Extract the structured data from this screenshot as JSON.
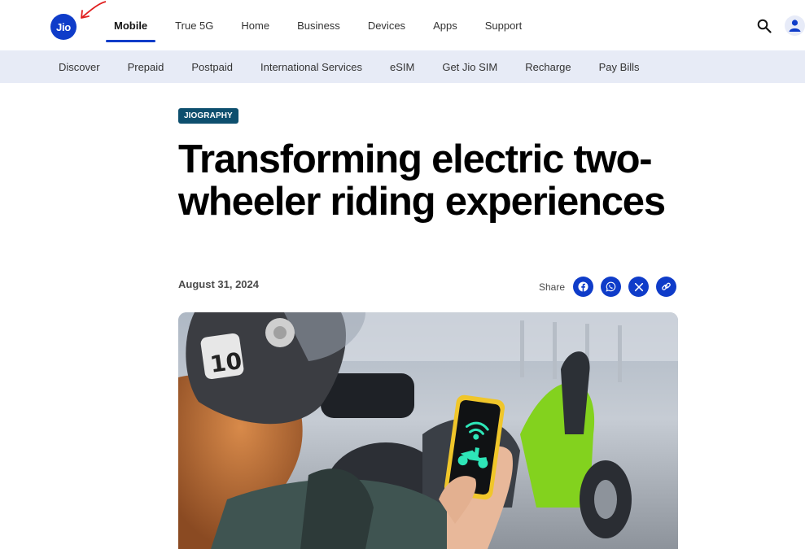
{
  "header": {
    "logo_text": "Jio",
    "nav": [
      {
        "label": "Mobile",
        "active": true
      },
      {
        "label": "True 5G"
      },
      {
        "label": "Home"
      },
      {
        "label": "Business"
      },
      {
        "label": "Devices"
      },
      {
        "label": "Apps"
      },
      {
        "label": "Support"
      }
    ]
  },
  "subnav": [
    "Discover",
    "Prepaid",
    "Postpaid",
    "International Services",
    "eSIM",
    "Get Jio SIM",
    "Recharge",
    "Pay Bills"
  ],
  "article": {
    "category": "JIOGRAPHY",
    "title": "Transforming electric two-wheeler riding experiences",
    "date": "August 31, 2024",
    "share_label": "Share"
  },
  "colors": {
    "brand": "#0f3cc9",
    "subnav_bg": "#e7ebf6",
    "badge": "#0d4f6e",
    "accent_green": "#8ee02a"
  },
  "icons": [
    "search-icon",
    "user-icon",
    "facebook-icon",
    "whatsapp-icon",
    "x-icon",
    "link-icon"
  ]
}
